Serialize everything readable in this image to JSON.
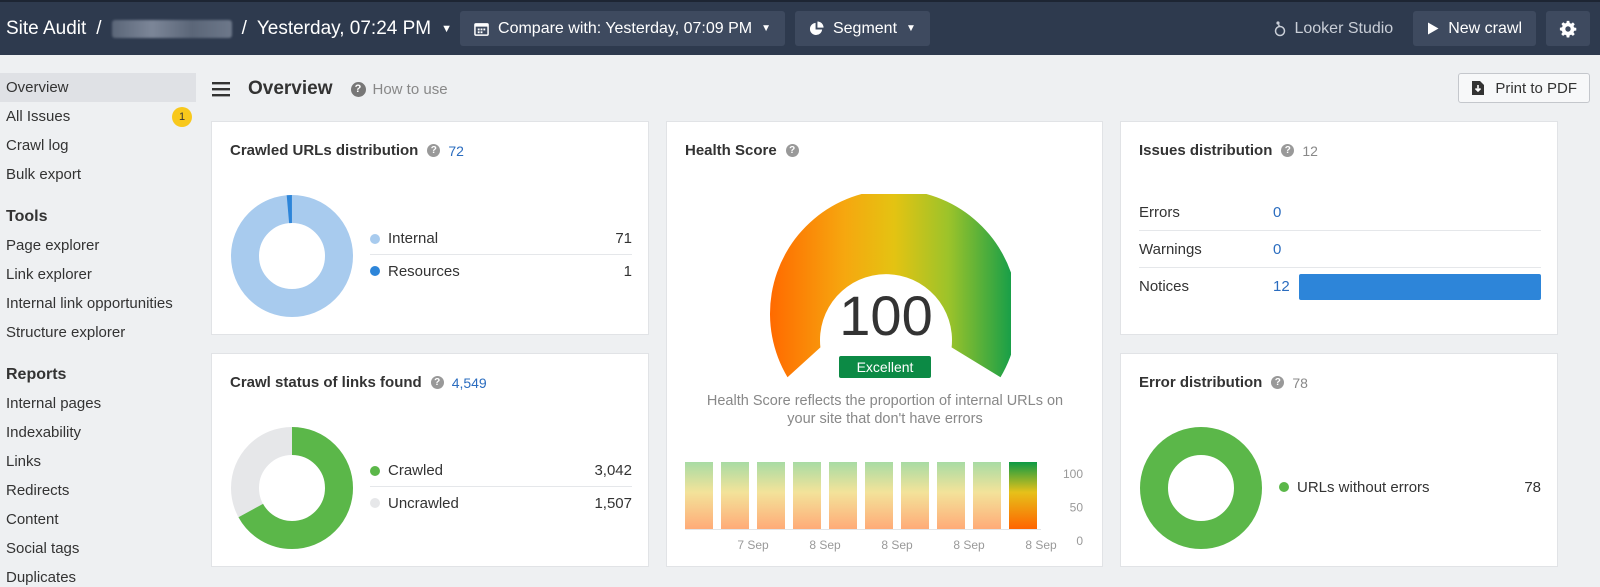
{
  "topbar": {
    "app_title": "Site Audit",
    "separator": "/",
    "date": "Yesterday, 07:24 PM",
    "compare_label": "Compare with: Yesterday, 07:09 PM",
    "segment_label": "Segment",
    "looker_label": "Looker Studio",
    "new_crawl_label": "New crawl"
  },
  "sidebar": {
    "items": [
      {
        "label": "Overview",
        "active": true
      },
      {
        "label": "All Issues",
        "badge": "1"
      },
      {
        "label": "Crawl log"
      },
      {
        "label": "Bulk export"
      }
    ],
    "tools_heading": "Tools",
    "tools": [
      {
        "label": "Page explorer"
      },
      {
        "label": "Link explorer"
      },
      {
        "label": "Internal link opportunities"
      },
      {
        "label": "Structure explorer"
      }
    ],
    "reports_heading": "Reports",
    "reports": [
      {
        "label": "Internal pages"
      },
      {
        "label": "Indexability"
      },
      {
        "label": "Links"
      },
      {
        "label": "Redirects"
      },
      {
        "label": "Content"
      },
      {
        "label": "Social tags"
      },
      {
        "label": "Duplicates"
      }
    ]
  },
  "main": {
    "title": "Overview",
    "how_to_use": "How to use",
    "print_label": "Print to PDF"
  },
  "crawled_urls": {
    "title": "Crawled URLs distribution",
    "count": "72",
    "rows": [
      {
        "label": "Internal",
        "value": "71",
        "color": "#a8cbee"
      },
      {
        "label": "Resources",
        "value": "1",
        "color": "#2d85d9"
      }
    ]
  },
  "crawl_status": {
    "title": "Crawl status of links found",
    "count": "4,549",
    "rows": [
      {
        "label": "Crawled",
        "value": "3,042",
        "color": "#5bb749"
      },
      {
        "label": "Uncrawled",
        "value": "1,507",
        "color": "#e6e7e9"
      }
    ]
  },
  "health": {
    "title": "Health Score",
    "score": "100",
    "rating": "Excellent",
    "description": "Health Score reflects the proportion of internal URLs on your site that don't have errors",
    "bars": [
      100,
      100,
      100,
      100,
      100,
      100,
      100,
      100,
      100,
      100
    ],
    "x_labels": [
      "7 Sep",
      "8 Sep",
      "8 Sep",
      "8 Sep",
      "8 Sep"
    ],
    "y_labels": [
      "100",
      "50",
      "0"
    ]
  },
  "issues": {
    "title": "Issues distribution",
    "count": "12",
    "rows": [
      {
        "label": "Errors",
        "value": "0",
        "fraction": 0
      },
      {
        "label": "Warnings",
        "value": "0",
        "fraction": 0
      },
      {
        "label": "Notices",
        "value": "12",
        "fraction": 1
      }
    ]
  },
  "errors": {
    "title": "Error distribution",
    "count": "78",
    "rows": [
      {
        "label": "URLs without errors",
        "value": "78",
        "color": "#5bb749"
      }
    ]
  }
}
